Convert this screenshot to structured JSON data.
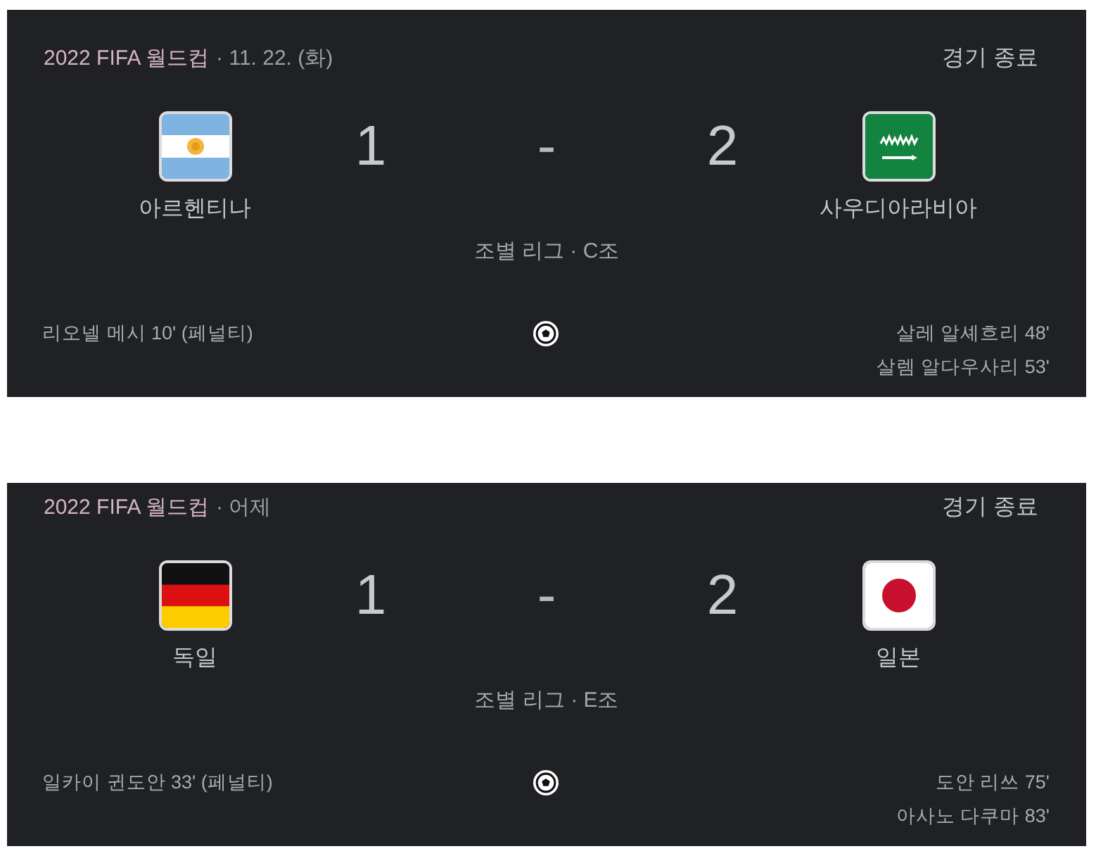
{
  "matches": [
    {
      "competition": "2022 FIFA 월드컵",
      "date": "· 11. 22. (화)",
      "status": "경기 종료",
      "home": {
        "name": "아르헨티나",
        "score": "1",
        "flag": {
          "kind": "argentina"
        }
      },
      "score_separator": "-",
      "away": {
        "name": "사우디아라비아",
        "score": "2",
        "flag": {
          "kind": "saudi"
        }
      },
      "stage": "조별 리그 · C조",
      "home_goals": [
        "리오넬 메시 10' (페널티)"
      ],
      "away_goals": [
        "살레 알셰흐리 48'",
        "살렘 알다우사리 53'"
      ]
    },
    {
      "competition": "2022 FIFA 월드컵",
      "date": "· 어제",
      "status": "경기 종료",
      "home": {
        "name": "독일",
        "score": "1",
        "flag": {
          "kind": "germany"
        }
      },
      "score_separator": "-",
      "away": {
        "name": "일본",
        "score": "2",
        "flag": {
          "kind": "japan"
        }
      },
      "stage": "조별 리그 · E조",
      "home_goals": [
        "일카이 귄도안 33' (페널티)"
      ],
      "away_goals": [
        "도안 리쓰 75'",
        "아사노 다쿠마 83'"
      ]
    }
  ]
}
